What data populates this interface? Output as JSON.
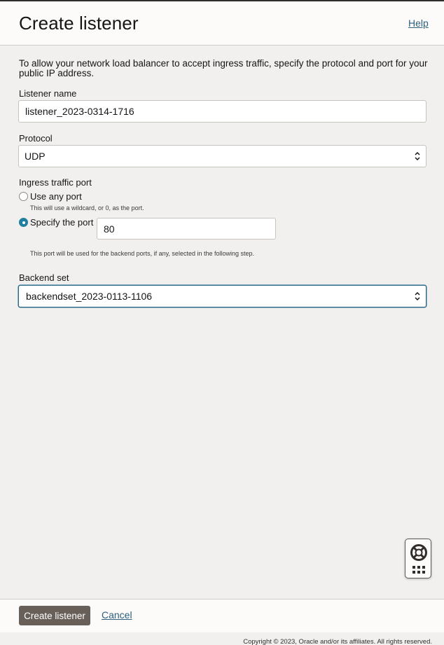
{
  "header": {
    "title": "Create listener",
    "help_label": "Help"
  },
  "intro": "To allow your network load balancer to accept ingress traffic, specify the protocol and port for your public IP address.",
  "listener_name": {
    "label": "Listener name",
    "value": "listener_2023-0314-1716"
  },
  "protocol": {
    "label": "Protocol",
    "value": "UDP"
  },
  "ingress_port": {
    "label": "Ingress traffic port",
    "options": [
      {
        "label": "Use any port",
        "hint": "This will use a wildcard, or 0, as the port.",
        "selected": false
      },
      {
        "label": "Specify the port",
        "selected": true
      }
    ],
    "port_value": "80",
    "port_hint": "This port will be used for the backend ports, if any, selected in the following step."
  },
  "backend_set": {
    "label": "Backend set",
    "value": "backendset_2023-0113-1106"
  },
  "help_widget": {
    "icons": [
      "lifebuoy-icon",
      "grid-icon"
    ]
  },
  "footer": {
    "primary_label": "Create listener",
    "cancel_label": "Cancel"
  },
  "copyright": "Copyright © 2023, Oracle and/or its affiliates. All rights reserved.",
  "colors": {
    "accent": "#227e9e",
    "link": "#2c5f7c",
    "primary_button": "#685f58",
    "page_bg": "#f1f0ef"
  }
}
